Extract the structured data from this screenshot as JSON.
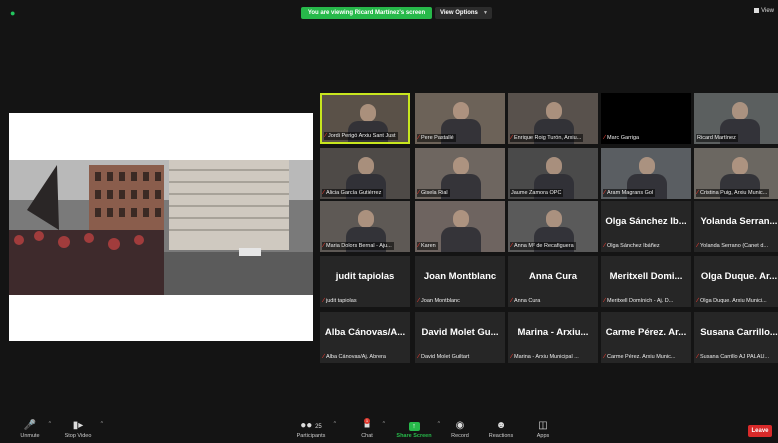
{
  "banner": {
    "viewing_text": "You are viewing Ricard Martínez's screen",
    "view_options_label": "View Options",
    "view_label": "View"
  },
  "participants_grid": [
    {
      "big": "",
      "label": "Jordi Perigó Arxiu Sant Just",
      "video": true,
      "active": true
    },
    {
      "big": "",
      "label": "Pere Pastallé",
      "video": true
    },
    {
      "big": "",
      "label": "Enrique Roig Turón, Arxiu...",
      "video": true
    },
    {
      "big": "",
      "label": "Marc Garriga",
      "video": false
    },
    {
      "big": "",
      "label": "Ricard Martínez",
      "video": true,
      "nomute": true
    },
    {
      "big": "",
      "label": "Alicia García Gutiérrez",
      "video": true
    },
    {
      "big": "",
      "label": "Gisela Rial",
      "video": true
    },
    {
      "big": "",
      "label": "Jaume Zamora OPC",
      "video": true,
      "nomute": true
    },
    {
      "big": "",
      "label": "Aram Magrans Gol",
      "video": true
    },
    {
      "big": "",
      "label": "Cristina Puig, Arxiu Munic...",
      "video": true
    },
    {
      "big": "",
      "label": "Maria Dolors Bernal - Aju...",
      "video": true
    },
    {
      "big": "",
      "label": "Karen",
      "video": true
    },
    {
      "big": "",
      "label": "Anna M² de Recafiguera",
      "video": true
    },
    {
      "big": "Olga Sánchez Ib...",
      "label": "Olga Sánchez Ibáñez",
      "video": false
    },
    {
      "big": "Yolanda Serran...",
      "label": "Yolanda Serrano (Canet d...",
      "video": false
    },
    {
      "big": "judit tapiolas",
      "label": "judit tapiolas",
      "video": false
    },
    {
      "big": "Joan Montblanc",
      "label": "Joan Montblanc",
      "video": false
    },
    {
      "big": "Anna Cura",
      "label": "Anna Cura",
      "video": false
    },
    {
      "big": "Meritxell Domi...",
      "label": "Meritxell Domínich - Aj. D...",
      "video": false
    },
    {
      "big": "Olga Duque. Ar...",
      "label": "Olga Duque. Arxiu Munici...",
      "video": false
    },
    {
      "big": "Alba Cánovas/A...",
      "label": "Alba Cánovas/Aj. Abrera",
      "video": false
    },
    {
      "big": "David Molet Gu...",
      "label": "David Molet Guiltart",
      "video": false
    },
    {
      "big": "Marina - Arxiu...",
      "label": "Marina - Arxiu Municipal ...",
      "video": false
    },
    {
      "big": "Carme Pérez. Ar...",
      "label": "Carme Pérez. Arxiu Munic...",
      "video": false
    },
    {
      "big": "Susana Carrillo...",
      "label": "Susana Carrillo AJ PALAU...",
      "video": false
    }
  ],
  "toolbar": {
    "unmute": "Unmute",
    "stop_video": "Stop Video",
    "participants": "Participants",
    "participants_count": "25",
    "chat": "Chat",
    "chat_badge": "1",
    "share_screen": "Share Screen",
    "record": "Record",
    "reactions": "Reactions",
    "apps": "Apps",
    "leave": "Leave"
  },
  "colors": {
    "active_speaker_border": "#c8e61e",
    "share_green": "#27b94a",
    "leave_red": "#d92a2a",
    "mute_red": "#e03a2f"
  }
}
